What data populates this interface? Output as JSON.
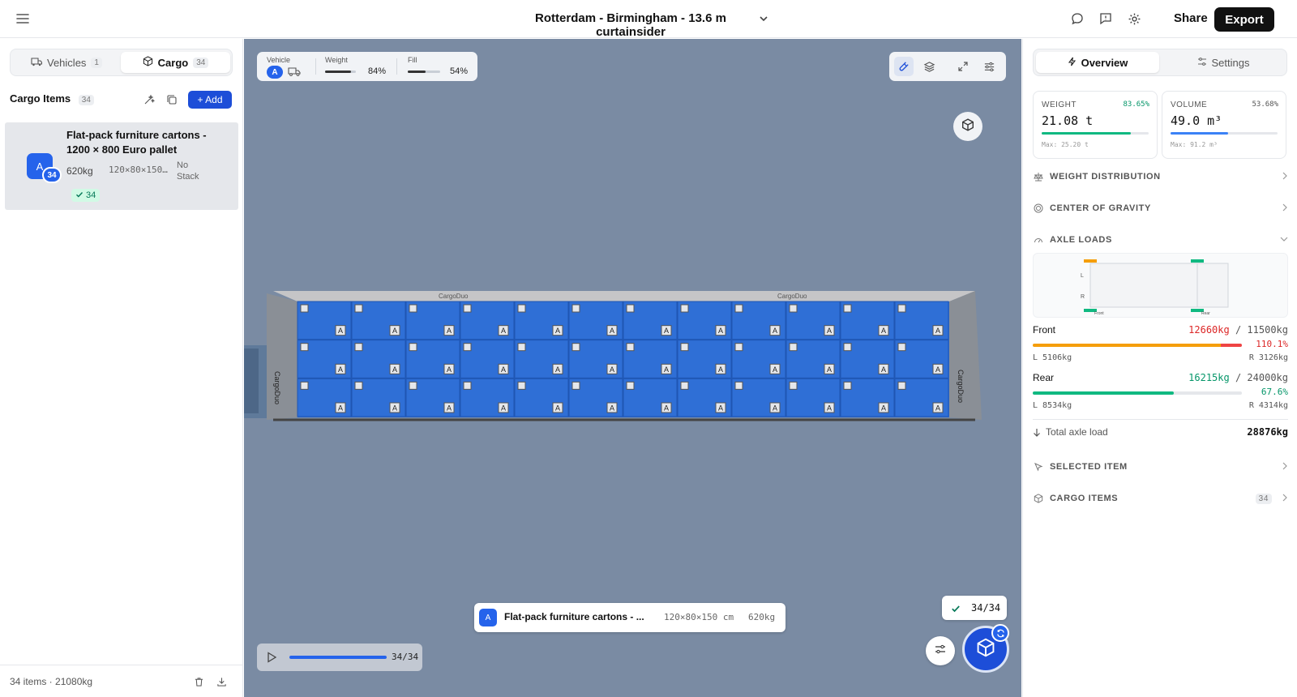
{
  "header": {
    "menu_icon": "hamburger-menu-icon",
    "title": "Rotterdam - Birmingham - 13.6 m curtainsider",
    "share_label": "Share",
    "export_label": "Export"
  },
  "left_panel": {
    "tabs": [
      {
        "label": "Vehicles",
        "count": "1"
      },
      {
        "label": "Cargo",
        "count": "34"
      }
    ],
    "cargo_header": {
      "title": "Cargo Items",
      "count": "34",
      "add_label": "+ Add"
    },
    "item": {
      "avatar": "A",
      "badge": "34",
      "name": "Flat-pack furniture cartons - 1200 × 800 Euro pallet",
      "weight": "620kg",
      "dims": "120×80×150 cm",
      "stack": "No Stack",
      "placed": "34"
    },
    "footer": {
      "summary": "34 items · 21080kg"
    }
  },
  "canvas": {
    "stats": {
      "vehicle_label": "Vehicle",
      "vehicle_letter": "A",
      "weight_label": "Weight",
      "weight_pct": "84%",
      "weight_level": 0.84,
      "fill_label": "Fill",
      "fill_pct": "54%",
      "fill_level": 0.54
    },
    "truck_brand": "CargoDuo",
    "box_label": "A",
    "info": {
      "avatar": "A",
      "name": "Flat-pack furniture cartons - ...",
      "dims": "120×80×150 cm",
      "weight": "620kg"
    },
    "done": "34/34",
    "playback": {
      "count": "34/34",
      "progress": 1.0
    }
  },
  "right_panel": {
    "tabs": [
      {
        "label": "Overview"
      },
      {
        "label": "Settings"
      }
    ],
    "weight_card": {
      "label": "WEIGHT",
      "pct": "83.65%",
      "value": "21.08 t",
      "max": "Max: 25.20 t",
      "level": 0.8365,
      "color": "#10b981"
    },
    "volume_card": {
      "label": "VOLUME",
      "pct": "53.68%",
      "value": "49.0 m³",
      "max": "Max: 91.2 m³",
      "level": 0.5368,
      "color": "#3b82f6"
    },
    "sections": {
      "weight_distribution": "WEIGHT DISTRIBUTION",
      "center_of_gravity": "CENTER OF GRAVITY",
      "axle_loads": "AXLE LOADS",
      "selected_item": "SELECTED ITEM",
      "cargo_items": "CARGO ITEMS",
      "cargo_items_count": "34"
    },
    "axle_diagram": {
      "left": "L",
      "right": "R",
      "front": "Front",
      "rear": "Rear"
    },
    "front": {
      "label": "Front",
      "load": "12660kg",
      "sep": " / ",
      "max": "11500kg",
      "pct": "110.1%",
      "level": 1.101,
      "left": "L 5106kg",
      "right": "R 3126kg"
    },
    "rear": {
      "label": "Rear",
      "load": "16215kg",
      "sep": " / ",
      "max": "24000kg",
      "pct": "67.6%",
      "level": 0.676,
      "left": "L 8534kg",
      "right": "R 4314kg"
    },
    "total": {
      "label": "Total axle load",
      "value": "28876kg"
    }
  },
  "colors": {
    "accent": "#1d4ed8",
    "ok": "#10b981",
    "danger": "#ef4444",
    "warn": "#f59e0b",
    "cargo": "#2f6fd6"
  }
}
